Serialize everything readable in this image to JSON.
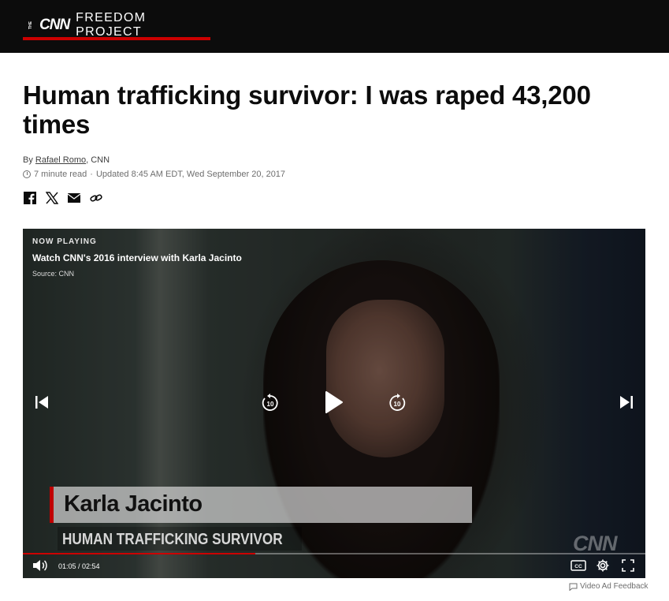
{
  "header": {
    "logo_small": "THE",
    "logo": "CNN",
    "section": "FREEDOM PROJECT",
    "accent": "#cc0000"
  },
  "article": {
    "headline": "Human trafficking survivor: I was raped 43,200 times",
    "byline_prefix": "By ",
    "author": "Rafael Romo",
    "byline_suffix": ", CNN",
    "read_time": "7 minute read",
    "separator": "·",
    "updated": "Updated 8:45 AM EDT, Wed September 20, 2017"
  },
  "share": {
    "icons": [
      "facebook-icon",
      "x-icon",
      "email-icon",
      "link-icon"
    ]
  },
  "video": {
    "now_playing": "NOW PLAYING",
    "title": "Watch CNN's 2016 interview with Karla Jacinto",
    "source": "Source: CNN",
    "lower_third_name": "Karla Jacinto",
    "lower_third_role": "HUMAN TRAFFICKING SURVIVOR",
    "watermark": "CNN",
    "skip_back_label": "10",
    "skip_forward_label": "10",
    "time": "01:05 / 02:54",
    "progress": 0.373,
    "controls": [
      "previous-icon",
      "replay-10-icon",
      "play-icon",
      "forward-10-icon",
      "next-icon",
      "volume-icon",
      "captions-icon",
      "settings-icon",
      "fullscreen-icon"
    ],
    "captions_label": "CC"
  },
  "feedback": {
    "label": "Video Ad Feedback"
  }
}
